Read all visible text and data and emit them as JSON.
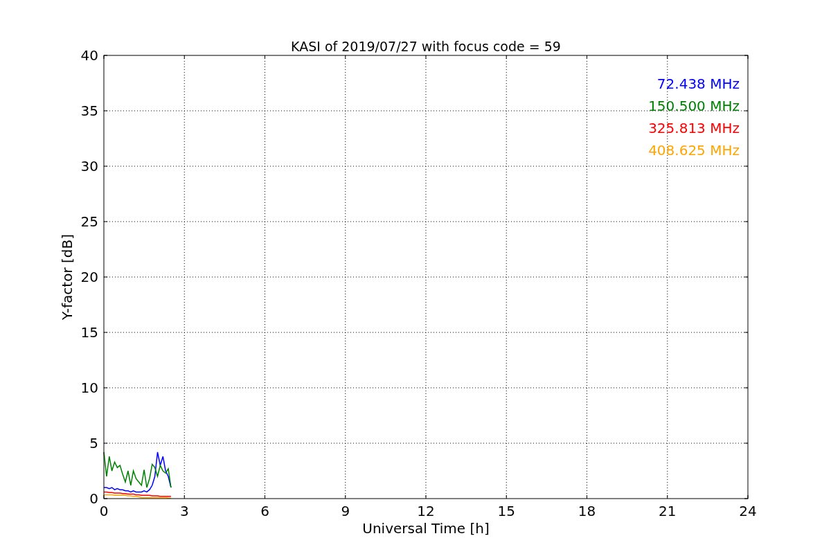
{
  "chart_data": {
    "type": "line",
    "title": "KASI of 2019/07/27 with focus code = 59",
    "xlabel": "Universal Time [h]",
    "ylabel": "Y-factor [dB]",
    "x": [
      0,
      0.1,
      0.2,
      0.3,
      0.4,
      0.5,
      0.6,
      0.7,
      0.8,
      0.9,
      1.0,
      1.1,
      1.2,
      1.3,
      1.4,
      1.5,
      1.6,
      1.7,
      1.8,
      1.9,
      2.0,
      2.1,
      2.2,
      2.3,
      2.4,
      2.5
    ],
    "series": [
      {
        "name": "72.438 MHz",
        "color": "#0000ff",
        "values": [
          1.0,
          1.0,
          0.9,
          1.0,
          0.8,
          0.9,
          0.8,
          0.8,
          0.7,
          0.7,
          0.6,
          0.7,
          0.6,
          0.6,
          0.6,
          0.7,
          0.6,
          0.8,
          1.2,
          2.0,
          4.2,
          3.0,
          3.8,
          2.5,
          2.0,
          1.0
        ]
      },
      {
        "name": "150.500 MHz",
        "color": "#008000",
        "values": [
          4.2,
          2.0,
          3.8,
          2.5,
          3.3,
          2.8,
          3.0,
          2.2,
          1.5,
          2.5,
          1.2,
          2.5,
          1.8,
          1.5,
          1.2,
          2.6,
          1.0,
          1.8,
          3.1,
          2.8,
          2.0,
          3.0,
          2.5,
          2.3,
          2.7,
          1.0
        ]
      },
      {
        "name": "325.813 MHz",
        "color": "#ff0000",
        "values": [
          0.6,
          0.6,
          0.55,
          0.55,
          0.5,
          0.5,
          0.5,
          0.45,
          0.45,
          0.4,
          0.4,
          0.4,
          0.35,
          0.35,
          0.3,
          0.3,
          0.3,
          0.3,
          0.25,
          0.25,
          0.25,
          0.2,
          0.2,
          0.2,
          0.2,
          0.2
        ]
      },
      {
        "name": "408.625 MHz",
        "color": "#ffa500",
        "values": [
          0.35,
          0.35,
          0.35,
          0.35,
          0.3,
          0.3,
          0.3,
          0.3,
          0.3,
          0.25,
          0.25,
          0.2,
          0.2,
          0.15,
          0.1,
          0.1,
          0.1,
          0.1,
          0.1,
          0.1,
          0.1,
          0.1,
          0.1,
          0.1,
          0.05,
          0.05
        ]
      }
    ],
    "xlim": [
      0,
      24
    ],
    "ylim": [
      0,
      40
    ],
    "xticks": [
      0,
      3,
      6,
      9,
      12,
      15,
      18,
      21,
      24
    ],
    "yticks": [
      0,
      5,
      10,
      15,
      20,
      25,
      30,
      35,
      40
    ],
    "grid": true
  }
}
